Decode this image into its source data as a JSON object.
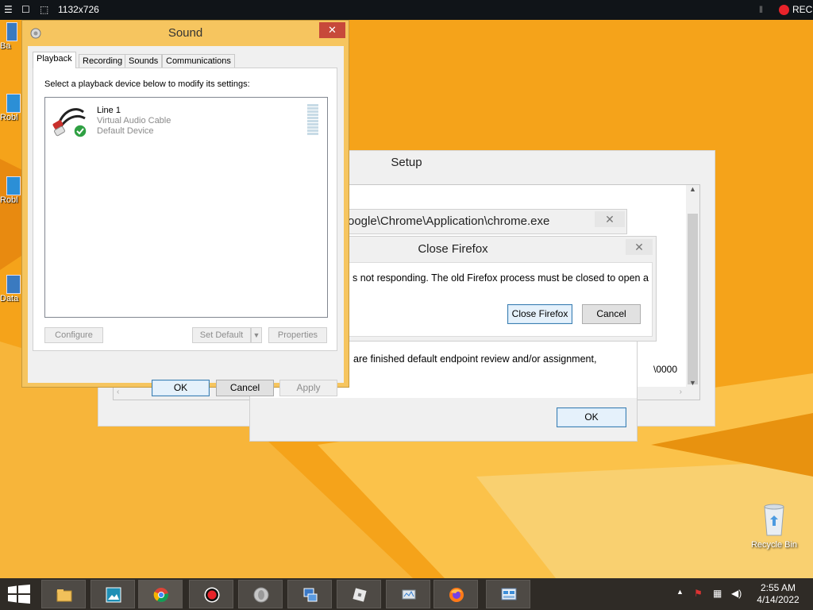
{
  "recorder_bar": {
    "dimensions": "1132x726",
    "rec_label": "REC"
  },
  "desktop_icons": [
    {
      "label": "Ba",
      "icon": "app-icon"
    },
    {
      "label": "Robl",
      "icon": "roblox-icon"
    },
    {
      "label": "Robl",
      "icon": "roblox-icon"
    },
    {
      "label": "Data",
      "icon": "app-icon"
    }
  ],
  "setup_window": {
    "title": "Setup",
    "line_endpoint": "are finished default endpoint review and/or assignment,",
    "line_suffix": "\\0000"
  },
  "path_dialog": {
    "path_text": "oogle\\Chrome\\Application\\chrome.exe",
    "close_label": "✕"
  },
  "endpoint_dialog": {
    "message": "are finished default endpoint review and/or assignment,",
    "ok_label": "OK"
  },
  "firefox_dialog": {
    "title": "Close Firefox",
    "close_label": "✕",
    "message": "s not responding. The old Firefox process must be closed to open a",
    "close_firefox_label": "Close Firefox",
    "cancel_label": "Cancel"
  },
  "sound_window": {
    "title": "Sound",
    "close_label": "✕",
    "tabs": [
      {
        "label": "Playback",
        "active": true
      },
      {
        "label": "Recording",
        "active": false
      },
      {
        "label": "Sounds",
        "active": false
      },
      {
        "label": "Communications",
        "active": false
      }
    ],
    "instruction": "Select a playback device below to modify its settings:",
    "devices": [
      {
        "name": "Line 1",
        "driver": "Virtual Audio Cable",
        "status": "Default Device"
      }
    ],
    "configure_label": "Configure",
    "set_default_label": "Set Default",
    "properties_label": "Properties",
    "ok_label": "OK",
    "cancel_label": "Cancel",
    "apply_label": "Apply"
  },
  "recycle_bin": {
    "label": "Recycle Bin"
  },
  "taskbar": {
    "apps": [
      "file-explorer-icon",
      "photo-viewer-icon",
      "chrome-icon",
      "recorder-icon",
      "speaker-icon",
      "network-setup-icon",
      "roblox-icon",
      "device-manager-icon",
      "firefox-icon",
      "control-panel-icon"
    ],
    "time": "2:55 AM",
    "date": "4/14/2022"
  },
  "colors": {
    "wallpaper_orange": "#f4a019",
    "sound_frame": "#f6c55f",
    "close_red": "#c7493a",
    "taskbar": "#2f2b26"
  }
}
